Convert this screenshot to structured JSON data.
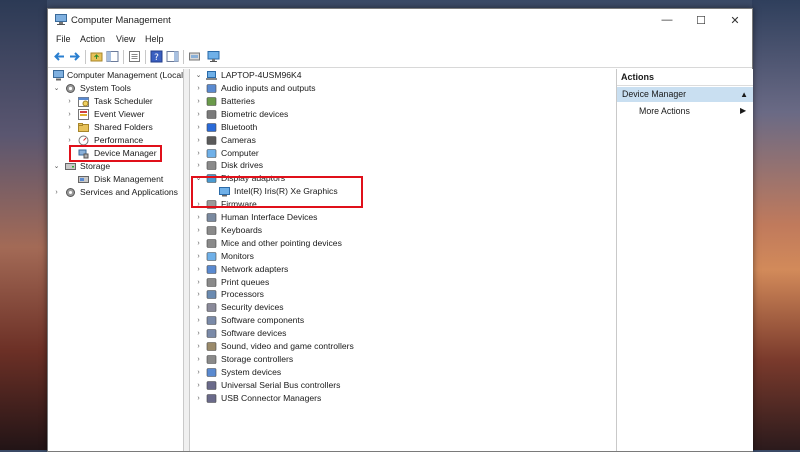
{
  "window": {
    "title": "Computer Management"
  },
  "controls": {
    "minimize": "—",
    "maximize": "☐",
    "close": "✕"
  },
  "menu": [
    "File",
    "Action",
    "View",
    "Help"
  ],
  "left_tree": {
    "root": "Computer Management (Local",
    "system_tools": "System Tools",
    "items": [
      "Task Scheduler",
      "Event Viewer",
      "Shared Folders",
      "Performance",
      "Device Manager"
    ],
    "storage": "Storage",
    "disk_management": "Disk Management",
    "services": "Services and Applications"
  },
  "device_tree": {
    "computer": "LAPTOP-4USM96K4",
    "categories": [
      "Audio inputs and outputs",
      "Batteries",
      "Biometric devices",
      "Bluetooth",
      "Cameras",
      "Computer",
      "Disk drives",
      "Display adaptors",
      "Firmware",
      "Human Interface Devices",
      "Keyboards",
      "Mice and other pointing devices",
      "Monitors",
      "Network adapters",
      "Print queues",
      "Processors",
      "Security devices",
      "Software components",
      "Software devices",
      "Sound, video and game controllers",
      "Storage controllers",
      "System devices",
      "Universal Serial Bus controllers",
      "USB Connector Managers"
    ],
    "display_child": "Intel(R) Iris(R) Xe Graphics"
  },
  "actions": {
    "header": "Actions",
    "selected": "Device Manager",
    "more": "More Actions"
  },
  "colors": {
    "highlight": "#e0101a",
    "selection": "#c9dff1"
  }
}
